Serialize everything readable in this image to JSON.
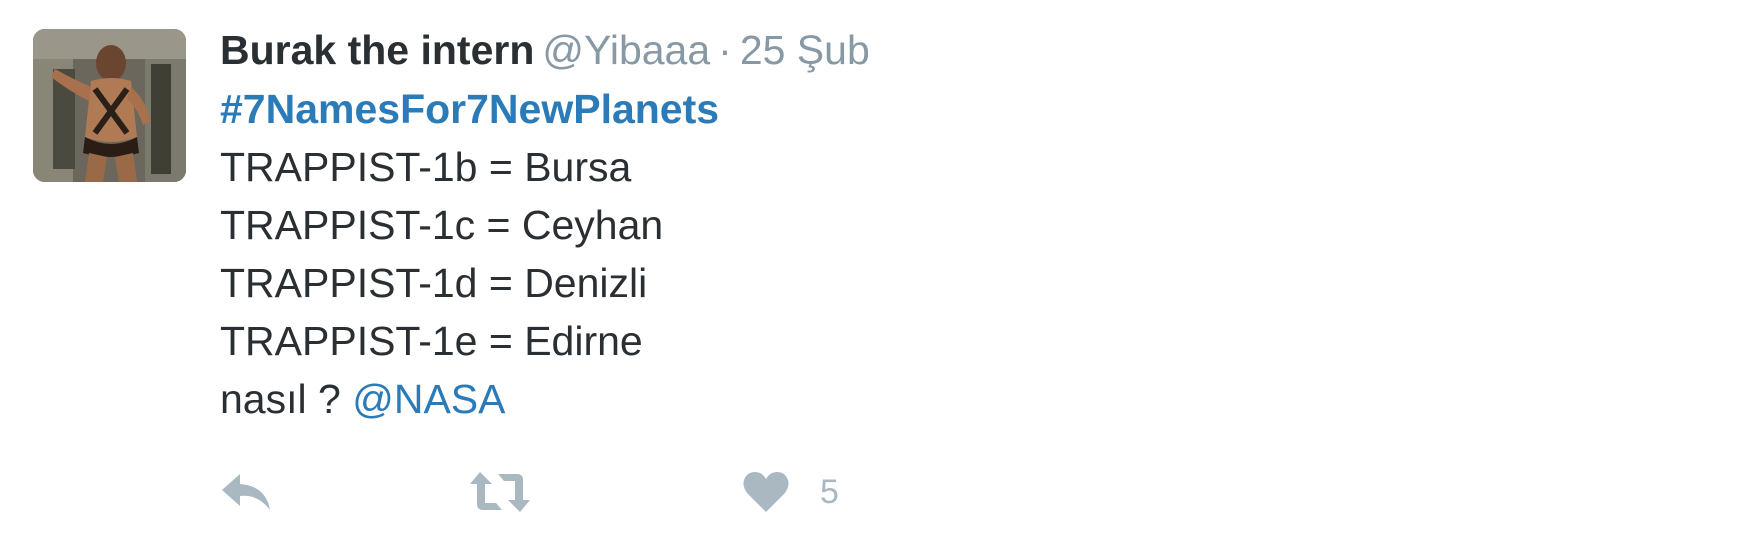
{
  "tweet": {
    "author": {
      "fullname": "Burak the intern",
      "username": "@Yibaaa",
      "separator": "·",
      "timestamp": "25 Şub"
    },
    "hashtag": "#7NamesFor7NewPlanets",
    "lines": [
      "TRAPPIST-1b = Bursa",
      "TRAPPIST-1c = Ceyhan",
      "TRAPPIST-1d = Denizli",
      "TRAPPIST-1e = Edirne"
    ],
    "last_line_prefix": "nasıl ?",
    "mention": "@NASA",
    "actions": {
      "reply_icon": "reply-icon",
      "retweet_icon": "retweet-icon",
      "like_icon": "heart-icon",
      "like_count": "5"
    },
    "colors": {
      "text": "#292f33",
      "muted": "#8899a6",
      "link": "#2b7bb9",
      "action_icon": "#aab8c2"
    }
  }
}
